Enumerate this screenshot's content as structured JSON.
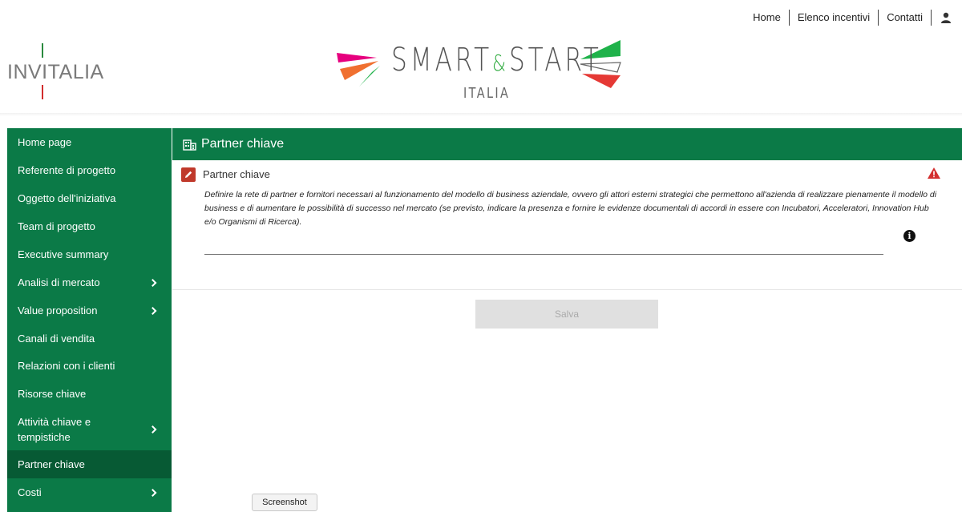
{
  "topnav": {
    "home": "Home",
    "incentives": "Elenco incentivi",
    "contacts": "Contatti",
    "user_icon": "user-icon"
  },
  "logos": {
    "invitalia": "INVITALIA",
    "smartstart_left": "SMART",
    "smartstart_amp": "&",
    "smartstart_right": "START",
    "smartstart_sub": "ITALIA"
  },
  "sidebar": {
    "items": [
      {
        "label": "Home page",
        "chevron": false,
        "active": false
      },
      {
        "label": "Referente di progetto",
        "chevron": false,
        "active": false
      },
      {
        "label": "Oggetto dell'iniziativa",
        "chevron": false,
        "active": false
      },
      {
        "label": "Team di progetto",
        "chevron": false,
        "active": false
      },
      {
        "label": "Executive summary",
        "chevron": false,
        "active": false
      },
      {
        "label": "Analisi di mercato",
        "chevron": true,
        "active": false
      },
      {
        "label": "Value proposition",
        "chevron": true,
        "active": false
      },
      {
        "label": "Canali di vendita",
        "chevron": false,
        "active": false
      },
      {
        "label": "Relazioni con i clienti",
        "chevron": false,
        "active": false
      },
      {
        "label": "Risorse chiave",
        "chevron": false,
        "active": false
      },
      {
        "label": "Attività chiave e tempistiche",
        "chevron": true,
        "active": false
      },
      {
        "label": "Partner chiave",
        "chevron": false,
        "active": true
      },
      {
        "label": "Costi",
        "chevron": true,
        "active": false
      }
    ]
  },
  "panel": {
    "title": "Partner chiave",
    "field_label": "Partner chiave",
    "description": "Definire la rete di partner e fornitori necessari al funzionamento del modello di business aziendale, ovvero gli attori esterni strategici che permettono all'azienda di realizzare pienamente il modello di business e di aumentare le possibilità di successo nel mercato (se previsto, indicare la presenza e fornire le evidenze documentali di accordi in essere con Incubatori, Acceleratori, Innovation Hub e/o Organismi di Ricerca).",
    "field_value": "",
    "info_glyph": "i"
  },
  "actions": {
    "save": "Salva",
    "screenshot": "Screenshot"
  },
  "colors": {
    "primary_green": "#0b7a47",
    "active_green": "#075a34",
    "warning_red": "#d32f2f",
    "edit_red": "#c0392b"
  }
}
